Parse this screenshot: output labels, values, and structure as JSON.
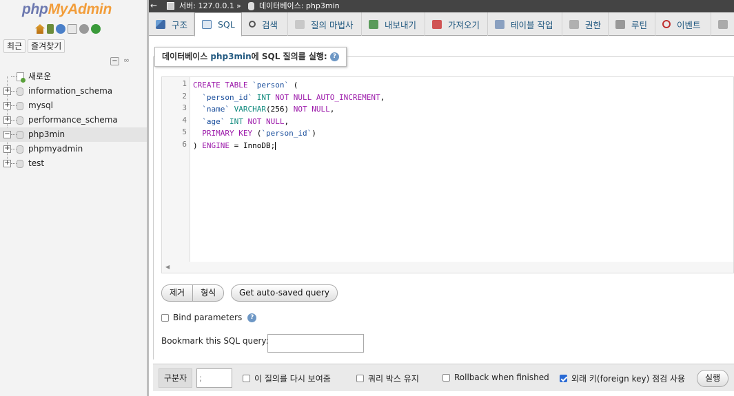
{
  "logo": {
    "php": "php",
    "myadmin": "MyAdmin"
  },
  "nav": {
    "tabs": [
      "최근",
      "즐겨찾기"
    ],
    "new_label": "새로운",
    "databases": [
      "information_schema",
      "mysql",
      "performance_schema",
      "php3min",
      "phpmyadmin",
      "test"
    ],
    "selected_db": "php3min"
  },
  "topbar": {
    "server": "서버: 127.0.0.1",
    "separator": "»",
    "database": "데이터베이스: php3min"
  },
  "tabs": [
    {
      "label": "구조",
      "icon": "structure-icon"
    },
    {
      "label": "SQL",
      "icon": "sql-icon"
    },
    {
      "label": "검색",
      "icon": "search-icon"
    },
    {
      "label": "질의 마법사",
      "icon": "query-icon"
    },
    {
      "label": "내보내기",
      "icon": "export-icon"
    },
    {
      "label": "가져오기",
      "icon": "import-icon"
    },
    {
      "label": "테이블 작업",
      "icon": "wrench-icon"
    },
    {
      "label": "권한",
      "icon": "privileges-icon"
    },
    {
      "label": "루틴",
      "icon": "routines-icon"
    },
    {
      "label": "이벤트",
      "icon": "events-icon"
    }
  ],
  "active_tab": "SQL",
  "legend": {
    "prefix": "데이터베이스 ",
    "db": "php3min",
    "suffix": "에 SQL 질의를 실행:"
  },
  "editor": {
    "line_numbers": [
      "1",
      "2",
      "3",
      "4",
      "5",
      "6"
    ],
    "sql": "CREATE TABLE `person` (\n  `person_id` INT NOT NULL AUTO_INCREMENT,\n  `name` VARCHAR(256) NOT NULL,\n  `age` INT NOT NULL,\n  PRIMARY KEY (`person_id`)\n) ENGINE = InnoDB;"
  },
  "buttons": {
    "clear": "제거",
    "format": "형식",
    "autosaved": "Get auto-saved query",
    "go": "실행"
  },
  "bind_parameters": {
    "label": "Bind parameters",
    "checked": false
  },
  "bookmark": {
    "label": "Bookmark this SQL query:",
    "value": ""
  },
  "bottom": {
    "delimiter_label": "구분자",
    "delimiter_value": ";",
    "options": [
      {
        "label": "이 질의를 다시 보여줌",
        "checked": false
      },
      {
        "label": "쿼리 박스 유지",
        "checked": false
      },
      {
        "label": "Rollback when finished",
        "checked": false
      },
      {
        "label": "외래 키(foreign key) 점검 사용",
        "checked": true
      }
    ]
  },
  "colors": {
    "accent": "#235a81",
    "topbar": "#444444",
    "logo_php": "#6c78af",
    "logo_myadmin": "#f29d3a"
  }
}
